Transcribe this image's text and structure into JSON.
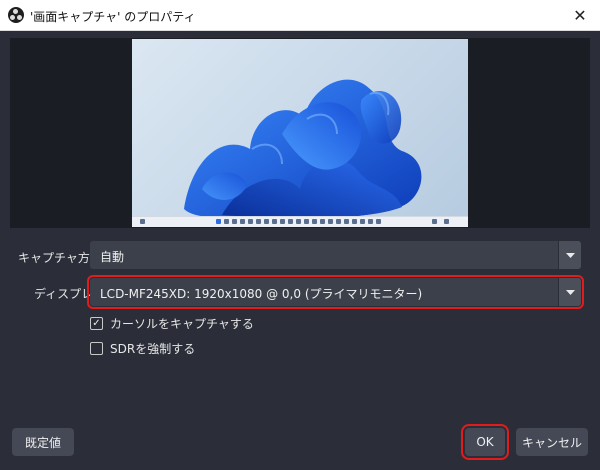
{
  "window": {
    "title": "'画面キャプチャ' のプロパティ",
    "close_glyph": "✕"
  },
  "icons": {
    "app": "obs-logo-icon",
    "close": "close-icon",
    "dropdown": "chevron-down-icon",
    "check": "checkmark-icon"
  },
  "preview": {
    "image": "windows-11-bloom-wallpaper",
    "background_colors": [
      "#dbe7f2",
      "#b6cbe0"
    ],
    "accent": "#1f5fe0"
  },
  "form": {
    "capture_method": {
      "label": "キャプチャ方法",
      "value": "自動"
    },
    "display": {
      "label": "ディスプレイ",
      "value": "LCD-MF245XD: 1920x1080 @ 0,0 (プライマリモニター)"
    },
    "capture_cursor": {
      "label": "カーソルをキャプチャする",
      "checked": true
    },
    "force_sdr": {
      "label": "SDRを強制する",
      "checked": false
    }
  },
  "buttons": {
    "defaults": "既定値",
    "ok": "OK",
    "cancel": "キャンセル"
  },
  "colors": {
    "highlight": "#e01c1c",
    "dialog_bg": "#2b2e38",
    "field_bg": "#3c404b"
  }
}
